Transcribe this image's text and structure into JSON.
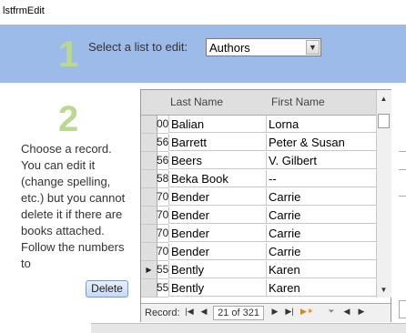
{
  "window": {
    "title": "lstfrmEdit"
  },
  "step1": {
    "number": "1",
    "label": "Select a list to edit:",
    "selected": "Authors"
  },
  "step2": {
    "number": "2",
    "instructions": "Choose a record. You can edit it (change spelling, etc.) but you cannot delete it if there are books attached. Follow the numbers to"
  },
  "delete_label": "Delete",
  "grid": {
    "columns": [
      "Last Name",
      "First Name"
    ],
    "rows": [
      {
        "id": "00",
        "last": "Balian",
        "first": "Lorna"
      },
      {
        "id": "56",
        "last": "Barrett",
        "first": "Peter & Susan"
      },
      {
        "id": "56",
        "last": "Beers",
        "first": "V. Gilbert"
      },
      {
        "id": "58",
        "last": "Beka Book",
        "first": "--"
      },
      {
        "id": "70",
        "last": "Bender",
        "first": "Carrie"
      },
      {
        "id": "70",
        "last": "Bender",
        "first": "Carrie"
      },
      {
        "id": "70",
        "last": "Bender",
        "first": "Carrie"
      },
      {
        "id": "70",
        "last": "Bender",
        "first": "Carrie"
      },
      {
        "id": "55",
        "last": "Bently",
        "first": "Karen",
        "current": true
      },
      {
        "id": "55",
        "last": "Bently",
        "first": "Karen"
      }
    ]
  },
  "nav": {
    "label": "Record:",
    "position": "21 of 321"
  },
  "icons": [
    "first-record-icon",
    "prev-record-icon",
    "next-record-icon",
    "last-record-icon",
    "new-record-icon",
    "filter-icon",
    "scroll-up-icon",
    "scroll-down-icon",
    "combo-dropdown-icon"
  ]
}
